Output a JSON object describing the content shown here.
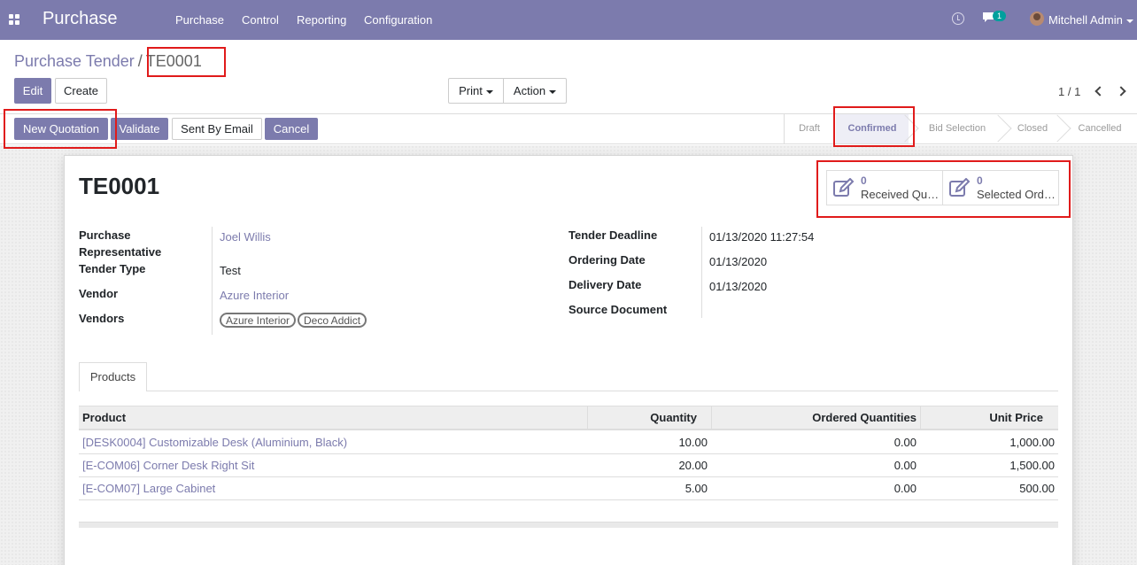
{
  "navbar": {
    "brand": "Purchase",
    "menu": [
      "Purchase",
      "Control",
      "Reporting",
      "Configuration"
    ],
    "chat_count": "1",
    "user": "Mitchell Admin"
  },
  "breadcrumb": {
    "parent": "Purchase Tender",
    "separator": "/",
    "current": "TE0001"
  },
  "controls": {
    "edit": "Edit",
    "create": "Create",
    "print": "Print",
    "action": "Action",
    "pager": "1 / 1"
  },
  "statusbar": {
    "buttons": {
      "new_quotation": "New Quotation",
      "validate": "Validate",
      "sent_by_email": "Sent By Email",
      "cancel": "Cancel"
    },
    "stages": [
      "Draft",
      "Confirmed",
      "Bid Selection",
      "Closed",
      "Cancelled"
    ],
    "active_stage": "Confirmed"
  },
  "record": {
    "title": "TE0001",
    "smart_buttons": [
      {
        "value": "0",
        "label": "Received Quotations"
      },
      {
        "value": "0",
        "label": "Selected Order Lines"
      }
    ],
    "left_fields": {
      "purchase_representative": {
        "label": "Purchase Representative",
        "value": "Joel Willis"
      },
      "tender_type": {
        "label": "Tender Type",
        "value": "Test"
      },
      "vendor": {
        "label": "Vendor",
        "value": "Azure Interior"
      },
      "vendors": {
        "label": "Vendors",
        "tags": [
          "Azure Interior",
          "Deco Addict"
        ]
      }
    },
    "right_fields": {
      "tender_deadline": {
        "label": "Tender Deadline",
        "value": "01/13/2020 11:27:54"
      },
      "ordering_date": {
        "label": "Ordering Date",
        "value": "01/13/2020"
      },
      "delivery_date": {
        "label": "Delivery Date",
        "value": "01/13/2020"
      },
      "source_document": {
        "label": "Source Document",
        "value": ""
      }
    }
  },
  "products": {
    "tab": "Products",
    "columns": [
      "Product",
      "Quantity",
      "Ordered Quantities",
      "Unit Price"
    ],
    "rows": [
      {
        "product": "[DESK0004] Customizable Desk (Aluminium, Black)",
        "quantity": "10.00",
        "ordered": "0.00",
        "price": "1,000.00"
      },
      {
        "product": "[E-COM06] Corner Desk Right Sit",
        "quantity": "20.00",
        "ordered": "0.00",
        "price": "1,500.00"
      },
      {
        "product": "[E-COM07] Large Cabinet",
        "quantity": "5.00",
        "ordered": "0.00",
        "price": "500.00"
      }
    ]
  },
  "colors": {
    "primary": "#7c7bad",
    "highlight": "#e01b1b",
    "chat_badge": "#00a09d"
  }
}
